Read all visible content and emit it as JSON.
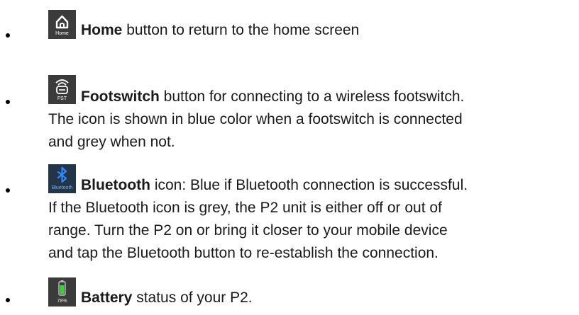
{
  "colors": {
    "text": "#1a1a1a",
    "icon_tile": "#3b3b3b",
    "bluetooth_tile": "#243449",
    "bluetooth_blue": "#2f8cff",
    "battery_green": "#3ecf3e"
  },
  "items": [
    {
      "icon": "home-icon",
      "icon_caption": "Home",
      "bold": "Home",
      "lines": [
        " button to return to the home screen"
      ]
    },
    {
      "icon": "footswitch-icon",
      "icon_caption": "FST",
      "bold": "Footswitch",
      "lines": [
        " button for connecting to a wireless footswitch.",
        "The icon is shown in blue color when a footswitch is connected",
        "and grey when not."
      ]
    },
    {
      "icon": "bluetooth-icon",
      "icon_caption": "Bluetooth",
      "bold": "Bluetooth",
      "lines": [
        " icon: Blue if Bluetooth connection is successful.",
        "If the Bluetooth icon is grey, the P2 unit is either off or out of",
        "range. Turn the P2 on or bring it closer to your mobile device",
        "and tap the Bluetooth button to re-establish the connection."
      ]
    },
    {
      "icon": "battery-icon",
      "icon_caption": "78%",
      "bold": "Battery",
      "lines": [
        " status of your P2."
      ]
    }
  ]
}
